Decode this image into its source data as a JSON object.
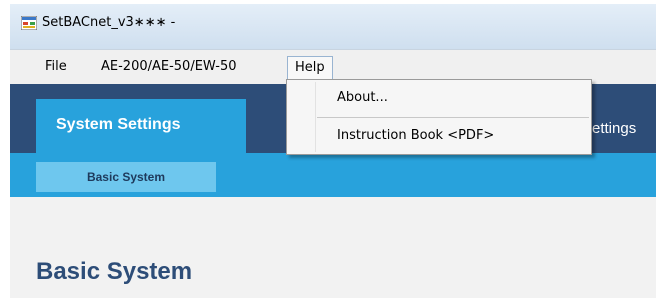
{
  "window": {
    "title": "SetBACnet_v3∗∗∗ -"
  },
  "menu": {
    "items": [
      {
        "label": "File"
      },
      {
        "label": "AE-200/AE-50/EW-50"
      },
      {
        "label": "Help"
      }
    ]
  },
  "help_menu": {
    "items": [
      {
        "label": "About..."
      },
      {
        "label": "Instruction Book <PDF>"
      }
    ]
  },
  "tabs": {
    "active": "System Settings",
    "partial": "ettings"
  },
  "subtabs": {
    "active": "Basic System"
  },
  "content": {
    "heading": "Basic System"
  },
  "colors": {
    "nav_band": "#2d4d78",
    "active_tab": "#28a2dc",
    "subtab": "#6ec7ee",
    "heading": "#2d4d78"
  }
}
